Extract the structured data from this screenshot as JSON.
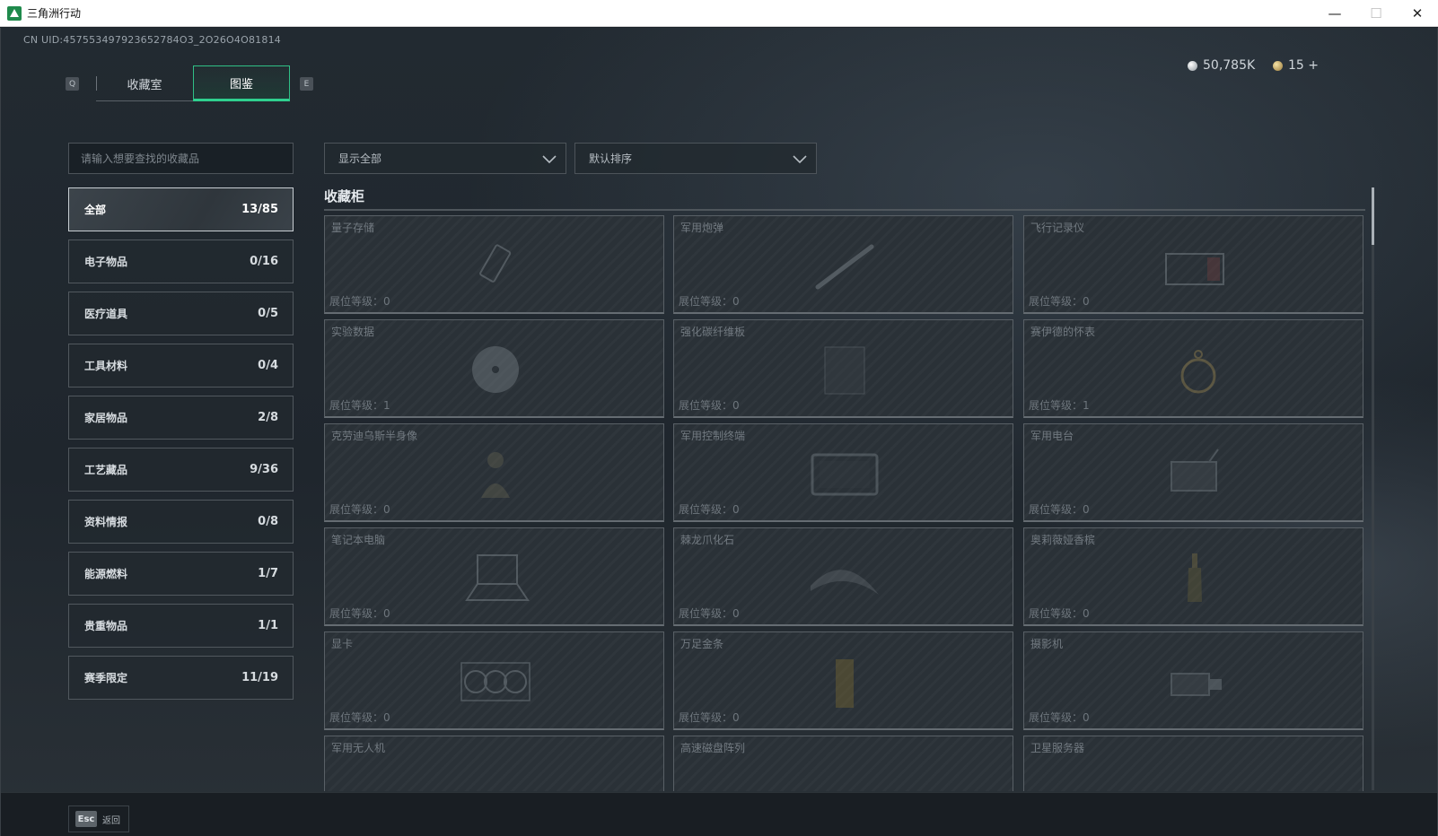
{
  "window": {
    "title": "三角洲行动",
    "minimize": "—",
    "maximize": "☐",
    "close": "✕"
  },
  "header": {
    "uid": "CN UID:457553497923652784O3_2O26O4O81814",
    "key_left": "Q",
    "key_right": "E",
    "tabs": [
      {
        "label": "收藏室",
        "active": false
      },
      {
        "label": "图鉴",
        "active": true
      }
    ],
    "currency_silver": "50,785K",
    "currency_gold": "15 +"
  },
  "search": {
    "placeholder": "请输入想要查找的收藏品"
  },
  "categories": [
    {
      "label": "全部",
      "count": "13/85",
      "active": true
    },
    {
      "label": "电子物品",
      "count": "0/16",
      "active": false
    },
    {
      "label": "医疗道具",
      "count": "0/5",
      "active": false
    },
    {
      "label": "工具材料",
      "count": "0/4",
      "active": false
    },
    {
      "label": "家居物品",
      "count": "2/8",
      "active": false
    },
    {
      "label": "工艺藏品",
      "count": "9/36",
      "active": false
    },
    {
      "label": "资料情报",
      "count": "0/8",
      "active": false
    },
    {
      "label": "能源燃料",
      "count": "1/7",
      "active": false
    },
    {
      "label": "贵重物品",
      "count": "1/1",
      "active": false
    },
    {
      "label": "赛季限定",
      "count": "11/19",
      "active": false
    }
  ],
  "filters": {
    "display": "显示全部",
    "sort": "默认排序"
  },
  "cabinet": {
    "title": "收藏柜",
    "items": [
      {
        "name": "量子存储",
        "level": "展位等级：0",
        "icon": "usb-drive-icon"
      },
      {
        "name": "军用炮弹",
        "level": "展位等级：0",
        "icon": "artillery-shell-icon"
      },
      {
        "name": "飞行记录仪",
        "level": "展位等级：0",
        "icon": "flight-recorder-icon"
      },
      {
        "name": "实验数据",
        "level": "展位等级：1",
        "icon": "disc-icon"
      },
      {
        "name": "强化碳纤维板",
        "level": "展位等级：0",
        "icon": "carbon-plate-icon"
      },
      {
        "name": "赛伊德的怀表",
        "level": "展位等级：1",
        "icon": "pocket-watch-icon"
      },
      {
        "name": "克劳迪乌斯半身像",
        "level": "展位等级：0",
        "icon": "bust-statue-icon"
      },
      {
        "name": "军用控制终端",
        "level": "展位等级：0",
        "icon": "control-terminal-icon"
      },
      {
        "name": "军用电台",
        "level": "展位等级：0",
        "icon": "radio-icon"
      },
      {
        "name": "笔记本电脑",
        "level": "展位等级：0",
        "icon": "laptop-icon"
      },
      {
        "name": "棘龙爪化石",
        "level": "展位等级：0",
        "icon": "claw-fossil-icon"
      },
      {
        "name": "奥莉薇娅香槟",
        "level": "展位等级：0",
        "icon": "champagne-bottle-icon"
      },
      {
        "name": "显卡",
        "level": "展位等级：0",
        "icon": "graphics-card-icon"
      },
      {
        "name": "万足金条",
        "level": "展位等级：0",
        "icon": "gold-bar-icon"
      },
      {
        "name": "摄影机",
        "level": "展位等级：0",
        "icon": "camera-icon"
      },
      {
        "name": "军用无人机",
        "level": "",
        "icon": "drone-icon"
      },
      {
        "name": "高速磁盘阵列",
        "level": "",
        "icon": "disk-array-icon"
      },
      {
        "name": "卫星服务器",
        "level": "",
        "icon": "server-icon"
      }
    ]
  },
  "footer": {
    "esc_key": "Esc",
    "esc_label": "返回"
  }
}
